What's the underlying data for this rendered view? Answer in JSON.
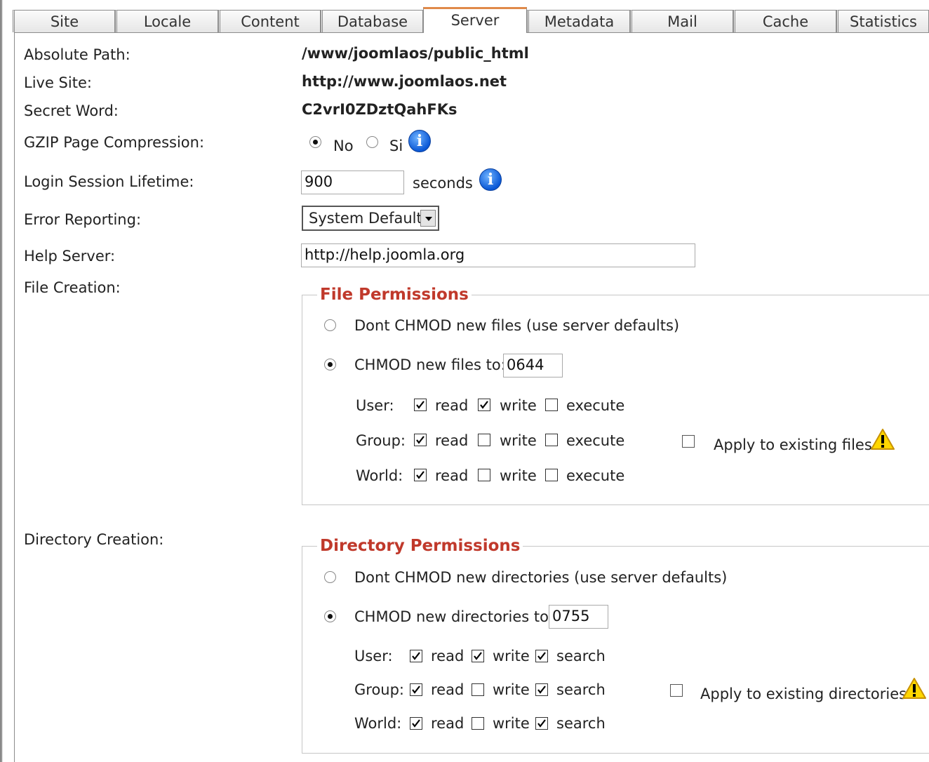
{
  "tabs": [
    "Site",
    "Locale",
    "Content",
    "Database",
    "Server",
    "Metadata",
    "Mail",
    "Cache",
    "Statistics"
  ],
  "active_tab": "Server",
  "rows": {
    "absolute_path": {
      "label": "Absolute Path:",
      "value": "/www/joomlaos/public_html"
    },
    "live_site": {
      "label": "Live Site:",
      "value": "http://www.joomlaos.net"
    },
    "secret_word": {
      "label": "Secret Word:",
      "value": "C2vrI0ZDztQahFKs"
    },
    "gzip": {
      "label": "GZIP Page Compression:",
      "opt_no": "No",
      "opt_si": "Si",
      "selected": "No"
    },
    "session": {
      "label": "Login Session Lifetime:",
      "value": "900",
      "unit": "seconds"
    },
    "error_reporting": {
      "label": "Error Reporting:",
      "value": "System Default"
    },
    "help_server": {
      "label": "Help Server:",
      "value": "http://help.joomla.org"
    },
    "file_creation": {
      "label": "File Creation:"
    },
    "directory_creation": {
      "label": "Directory Creation:"
    }
  },
  "file_perms": {
    "legend": "File Permissions",
    "opt_default": "Dont CHMOD new files (use server defaults)",
    "opt_chmod": "CHMOD new files to:",
    "chmod_value": "0644",
    "user_label": "User:",
    "group_label": "Group:",
    "world_label": "World:",
    "read": "read",
    "write": "write",
    "execute": "execute",
    "apply": "Apply to existing files",
    "matrix": {
      "user": [
        true,
        true,
        false
      ],
      "group": [
        true,
        false,
        false
      ],
      "world": [
        true,
        false,
        false
      ]
    }
  },
  "dir_perms": {
    "legend": "Directory Permissions",
    "opt_default": "Dont CHMOD new directories (use server defaults)",
    "opt_chmod": "CHMOD new directories to:",
    "chmod_value": "0755",
    "user_label": "User:",
    "group_label": "Group:",
    "world_label": "World:",
    "read": "read",
    "write": "write",
    "search": "search",
    "apply": "Apply to existing directories",
    "matrix": {
      "user": [
        true,
        true,
        true
      ],
      "group": [
        true,
        false,
        true
      ],
      "world": [
        true,
        false,
        true
      ]
    }
  },
  "colors": {
    "legend": "#c0392b",
    "active_tab_accent": "#e08a4a",
    "info_icon": "#0a58d6"
  }
}
